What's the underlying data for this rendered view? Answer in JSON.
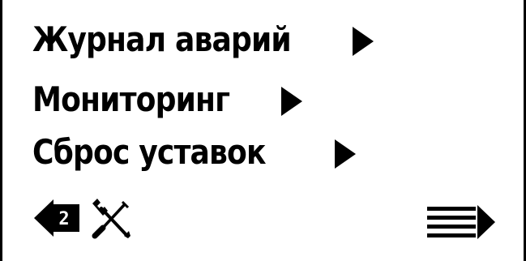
{
  "menu": {
    "items": [
      {
        "label": "Журнал аварий"
      },
      {
        "label": "Мониторинг"
      },
      {
        "label": "Сброс уставок"
      }
    ]
  },
  "footer": {
    "back_page_number": "2",
    "back_icon": "arrow-left-icon",
    "tools_icon": "tools-icon",
    "next_icon": "menu-next-icon"
  },
  "colors": {
    "foreground": "#000000",
    "background": "#ffffff"
  }
}
